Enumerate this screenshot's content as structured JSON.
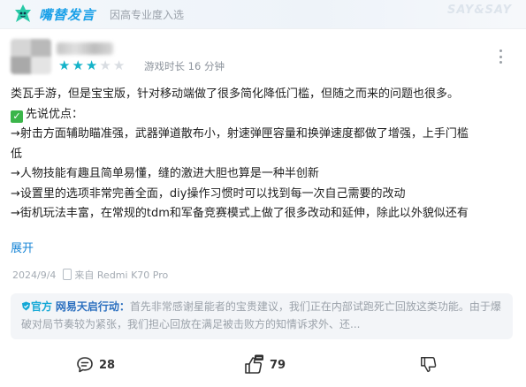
{
  "topbar": {
    "brand": "嘴替发言",
    "subtitle": "因高专业度入选",
    "watermark": "SAY&SAY"
  },
  "review": {
    "rating": 3,
    "rating_max": 5,
    "playtime": "游戏时长 16 分钟",
    "lines": [
      "类瓦手游，但是宝宝版，针对移动端做了很多简化降低门槛，但随之而来的问题也很多。",
      "先说优点：",
      "→射击方面辅助瞄准强，武器弹道散布小，射速弹匣容量和换弹速度都做了增强，上手门槛",
      "低",
      "→人物技能有趣且简单易懂，缝的激进大胆也算是一种半创新",
      "→设置里的选项非常完善全面，diy操作习惯时可以找到每一次自己需要的改动",
      "→街机玩法丰富，在常规的tdm和军备竞赛模式上做了很多改动和延伸，除此以外貌似还有"
    ],
    "expand_label": "展开",
    "date": "2024/9/4",
    "device": "来自 Redmi K70 Pro"
  },
  "official_reply": {
    "badge": "官方",
    "author": "网易天启行动：",
    "text": "首先非常感谢星能者的宝贵建议，我们正在内部试跑死亡回放这类功能。由于爆破对局节奏较为紧张，我们担心回放在满足被击败方的知情诉求外、还..."
  },
  "actions": {
    "comments": "28",
    "likes": "79"
  },
  "colors": {
    "accent": "#1aa0e8",
    "star_on": "#14b3c9",
    "link": "#1684d6"
  }
}
